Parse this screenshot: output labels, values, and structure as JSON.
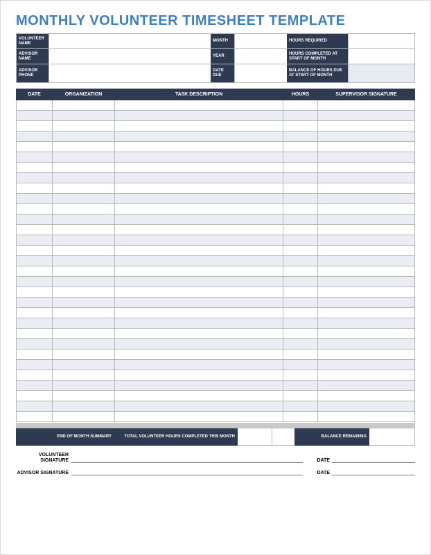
{
  "title": "MONTHLY VOLUNTEER TIMESHEET TEMPLATE",
  "info": {
    "volunteer_name_label": "VOLUNTEER NAME",
    "advisor_name_label": "ADVISOR NAME",
    "advisor_phone_label": "ADVISOR PHONE",
    "month_label": "MONTH",
    "year_label": "YEAR",
    "date_due_label": "DATE DUE",
    "hours_required_label": "HOURS REQUIRED",
    "hours_completed_label": "HOURS COMPLETED AT START OF MONTH",
    "balance_due_label": "BALANCE OF HOURS DUE AT START OF MONTH",
    "volunteer_name": "",
    "advisor_name": "",
    "advisor_phone": "",
    "month": "",
    "year": "",
    "date_due": "",
    "hours_required": "",
    "hours_completed": "",
    "balance_due": ""
  },
  "columns": {
    "date": "DATE",
    "organization": "ORGANIZATION",
    "task": "TASK DESCRIPTION",
    "hours": "HOURS",
    "signature": "SUPERVISOR SIGNATURE"
  },
  "rows": [
    {
      "date": "",
      "organization": "",
      "task": "",
      "hours": "",
      "signature": ""
    },
    {
      "date": "",
      "organization": "",
      "task": "",
      "hours": "",
      "signature": ""
    },
    {
      "date": "",
      "organization": "",
      "task": "",
      "hours": "",
      "signature": ""
    },
    {
      "date": "",
      "organization": "",
      "task": "",
      "hours": "",
      "signature": ""
    },
    {
      "date": "",
      "organization": "",
      "task": "",
      "hours": "",
      "signature": ""
    },
    {
      "date": "",
      "organization": "",
      "task": "",
      "hours": "",
      "signature": ""
    },
    {
      "date": "",
      "organization": "",
      "task": "",
      "hours": "",
      "signature": ""
    },
    {
      "date": "",
      "organization": "",
      "task": "",
      "hours": "",
      "signature": ""
    },
    {
      "date": "",
      "organization": "",
      "task": "",
      "hours": "",
      "signature": ""
    },
    {
      "date": "",
      "organization": "",
      "task": "",
      "hours": "",
      "signature": ""
    },
    {
      "date": "",
      "organization": "",
      "task": "",
      "hours": "",
      "signature": ""
    },
    {
      "date": "",
      "organization": "",
      "task": "",
      "hours": "",
      "signature": ""
    },
    {
      "date": "",
      "organization": "",
      "task": "",
      "hours": "",
      "signature": ""
    },
    {
      "date": "",
      "organization": "",
      "task": "",
      "hours": "",
      "signature": ""
    },
    {
      "date": "",
      "organization": "",
      "task": "",
      "hours": "",
      "signature": ""
    },
    {
      "date": "",
      "organization": "",
      "task": "",
      "hours": "",
      "signature": ""
    },
    {
      "date": "",
      "organization": "",
      "task": "",
      "hours": "",
      "signature": ""
    },
    {
      "date": "",
      "organization": "",
      "task": "",
      "hours": "",
      "signature": ""
    },
    {
      "date": "",
      "organization": "",
      "task": "",
      "hours": "",
      "signature": ""
    },
    {
      "date": "",
      "organization": "",
      "task": "",
      "hours": "",
      "signature": ""
    },
    {
      "date": "",
      "organization": "",
      "task": "",
      "hours": "",
      "signature": ""
    },
    {
      "date": "",
      "organization": "",
      "task": "",
      "hours": "",
      "signature": ""
    },
    {
      "date": "",
      "organization": "",
      "task": "",
      "hours": "",
      "signature": ""
    },
    {
      "date": "",
      "organization": "",
      "task": "",
      "hours": "",
      "signature": ""
    },
    {
      "date": "",
      "organization": "",
      "task": "",
      "hours": "",
      "signature": ""
    },
    {
      "date": "",
      "organization": "",
      "task": "",
      "hours": "",
      "signature": ""
    },
    {
      "date": "",
      "organization": "",
      "task": "",
      "hours": "",
      "signature": ""
    },
    {
      "date": "",
      "organization": "",
      "task": "",
      "hours": "",
      "signature": ""
    },
    {
      "date": "",
      "organization": "",
      "task": "",
      "hours": "",
      "signature": ""
    },
    {
      "date": "",
      "organization": "",
      "task": "",
      "hours": "",
      "signature": ""
    },
    {
      "date": "",
      "organization": "",
      "task": "",
      "hours": "",
      "signature": ""
    }
  ],
  "summary": {
    "eom_label": "END OF MONTH SUMMARY",
    "total_label": "TOTAL VOLUNTEER HOURS COMPLETED THIS MONTH",
    "total_value": "",
    "balance_label": "BALANCE REMAINING",
    "balance_value": ""
  },
  "signatures": {
    "volunteer_label": "VOLUNTEER SIGNATURE",
    "advisor_label": "ADVISOR SIGNATURE",
    "date_label": "DATE"
  }
}
